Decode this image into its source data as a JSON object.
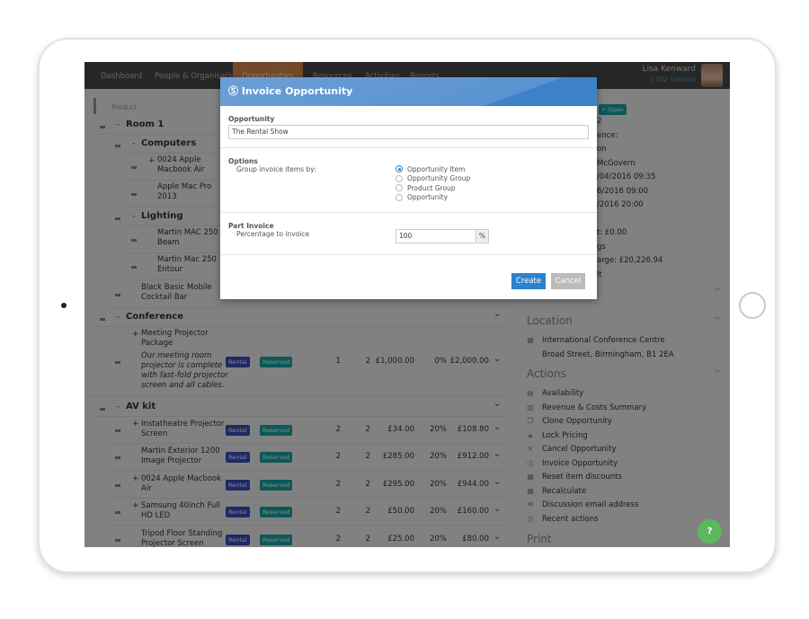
{
  "nav": {
    "items": [
      "Dashboard",
      "People & Organisations",
      "Opportunities",
      "Resources",
      "Activities",
      "Reports"
    ],
    "active": "Opportunities",
    "user_name": "Lisa Kenward",
    "user_location": "IAV: London"
  },
  "list": {
    "header": "Product",
    "rows": [
      {
        "type": "group",
        "name": "Room 1",
        "sign": "-"
      },
      {
        "type": "subgroup",
        "name": "Computers",
        "sign": "-"
      },
      {
        "type": "item",
        "l1": "0024 Apple",
        "l2": "Macbook Air",
        "plus": "+"
      },
      {
        "type": "item",
        "l1": "Apple Mac Pro",
        "l2": "2013"
      },
      {
        "type": "subgroup",
        "name": "Lighting",
        "sign": "-"
      },
      {
        "type": "item",
        "l1": "Martin MAC 250",
        "l2": "Beam"
      },
      {
        "type": "item",
        "l1": "Martin Mac 250",
        "l2": "Entour"
      },
      {
        "type": "item2",
        "l1": "Black Basic Mobile",
        "l2": "Cocktail Bar"
      },
      {
        "type": "group",
        "name": "Conference",
        "sign": "-"
      },
      {
        "type": "group",
        "name": "AV kit",
        "sign": "-"
      }
    ],
    "conference_item": {
      "l1": "Meeting Projector",
      "l2": "Package",
      "plus": "+",
      "desc": [
        "Our meeting room",
        "projector is complete",
        "with fast-fold projector",
        "screen and all cables."
      ],
      "type": "Rental",
      "status": "Reserved",
      "qty": "1",
      "days": "2",
      "price": "£1,000.00",
      "discount": "0%",
      "total": "£2,000.00"
    },
    "av_items": [
      {
        "l1": "Instatheatre Projector",
        "l2": "Screen",
        "plus": "+",
        "type": "Rental",
        "status": "Reserved",
        "qty": "2",
        "days": "2",
        "price": "£34.00",
        "discount": "20%",
        "total": "£108.80"
      },
      {
        "l1": "Martin Exterior 1200",
        "l2": "Image Projector",
        "plus": "",
        "type": "Rental",
        "status": "Reserved",
        "qty": "2",
        "days": "2",
        "price": "£285.00",
        "discount": "20%",
        "total": "£912.00"
      },
      {
        "l1": "0024 Apple Macbook",
        "l2": "Air",
        "plus": "+",
        "type": "Rental",
        "status": "Reserved",
        "qty": "2",
        "days": "2",
        "price": "£295.00",
        "discount": "20%",
        "total": "£944.00"
      },
      {
        "l1": "Samsung 40inch Full",
        "l2": "HD LED",
        "plus": "+",
        "type": "Rental",
        "status": "Reserved",
        "qty": "2",
        "days": "2",
        "price": "£50.00",
        "discount": "20%",
        "total": "£160.00"
      },
      {
        "l1": "Tripod Floor Standing",
        "l2": "Projector Screen",
        "plus": "",
        "type": "Rental",
        "status": "Reserved",
        "qty": "2",
        "days": "2",
        "price": "£25.00",
        "discount": "20%",
        "total": "£80.00"
      }
    ]
  },
  "right": {
    "status_badge": "Open",
    "fragments": [
      "2",
      "ence:",
      "on",
      "McGovern",
      "/04/2016 09:35",
      "6/2016 09:00",
      "/2016 20:00",
      "",
      "t: £0.00",
      "gs",
      "arge: £20,226.94",
      "lt"
    ],
    "location_title": "Location",
    "location_name": "International Conference Centre",
    "location_address": "Broad Street, Birmingham, B1 2EA",
    "actions_title": "Actions",
    "actions": [
      {
        "label": "Availability",
        "icon": "calendar-icon"
      },
      {
        "label": "Revenue & Costs Summary",
        "icon": "chart-icon"
      },
      {
        "label": "Clone Opportunity",
        "icon": "copy-icon"
      },
      {
        "label": "Lock Pricing",
        "icon": "lock-icon"
      },
      {
        "label": "Cancel Opportunity",
        "icon": "cross-icon"
      },
      {
        "label": "Invoice Opportunity",
        "icon": "dollar-circle-icon"
      },
      {
        "label": "Reset item discounts",
        "icon": "grid-icon"
      },
      {
        "label": "Recalculate",
        "icon": "grid-icon"
      },
      {
        "label": "Discussion email address",
        "icon": "envelope-icon"
      },
      {
        "label": "Recent actions",
        "icon": "clock-icon"
      }
    ],
    "print_title": "Print"
  },
  "modal": {
    "title": "Invoice Opportunity",
    "close": "×",
    "opportunity_label": "Opportunity",
    "opportunity_value": "The Rental Show",
    "options_label": "Options",
    "group_by_label": "Group invoice items by:",
    "group_options": [
      "Opportunity Item",
      "Opportunity Group",
      "Product Group",
      "Opportunity"
    ],
    "group_selected": "Opportunity Item",
    "part_invoice_label": "Part Invoice",
    "percentage_label": "Percentage to invoice",
    "percentage_value": "100",
    "percent_suffix": "%",
    "create": "Create",
    "cancel": "Cancel"
  },
  "help": "?",
  "colors": {
    "nav_active": "#d98a4e",
    "primary": "#2a83d0",
    "rental": "#3a4fbf",
    "reserved": "#1aa4a6",
    "help": "#5cb85c"
  }
}
